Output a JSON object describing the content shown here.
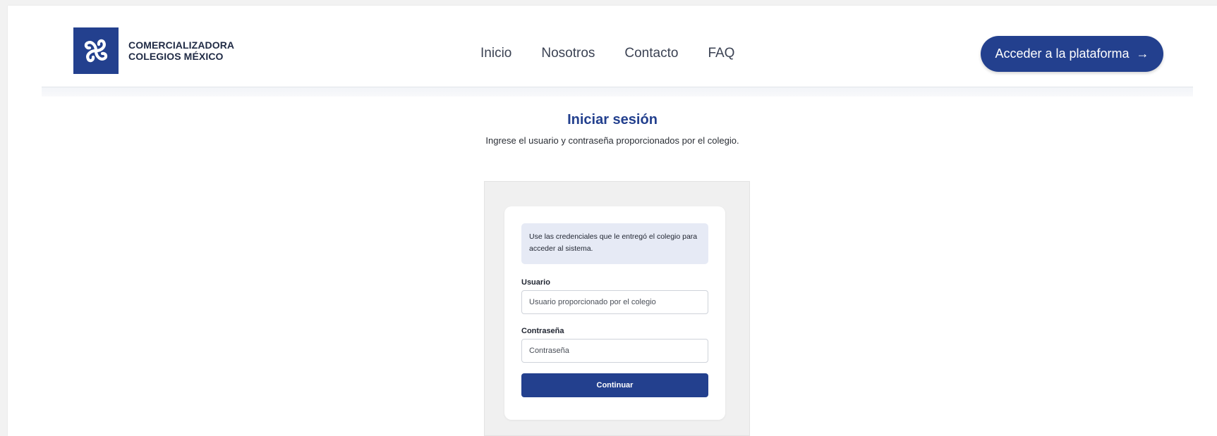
{
  "brand": {
    "line1": "COMERCIALIZADORA",
    "line2": "COLEGIOS MÉXICO",
    "color": "#23408e"
  },
  "nav": {
    "items": [
      {
        "label": "Inicio"
      },
      {
        "label": "Nosotros"
      },
      {
        "label": "Contacto"
      },
      {
        "label": "FAQ"
      }
    ]
  },
  "cta": {
    "label": "Acceder a la plataforma",
    "icon": "arrow-right-icon",
    "glyph": "→"
  },
  "login": {
    "title": "Iniciar sesión",
    "subtitle": "Ingrese el usuario y contraseña proporcionados por el colegio.",
    "info": "Use las credenciales que le entregó el colegio para acceder al sistema.",
    "user_label": "Usuario",
    "user_placeholder": "Usuario proporcionado por el colegio",
    "user_value": "",
    "password_label": "Contraseña",
    "password_placeholder": "Contraseña",
    "password_value": "",
    "submit_label": "Continuar"
  }
}
